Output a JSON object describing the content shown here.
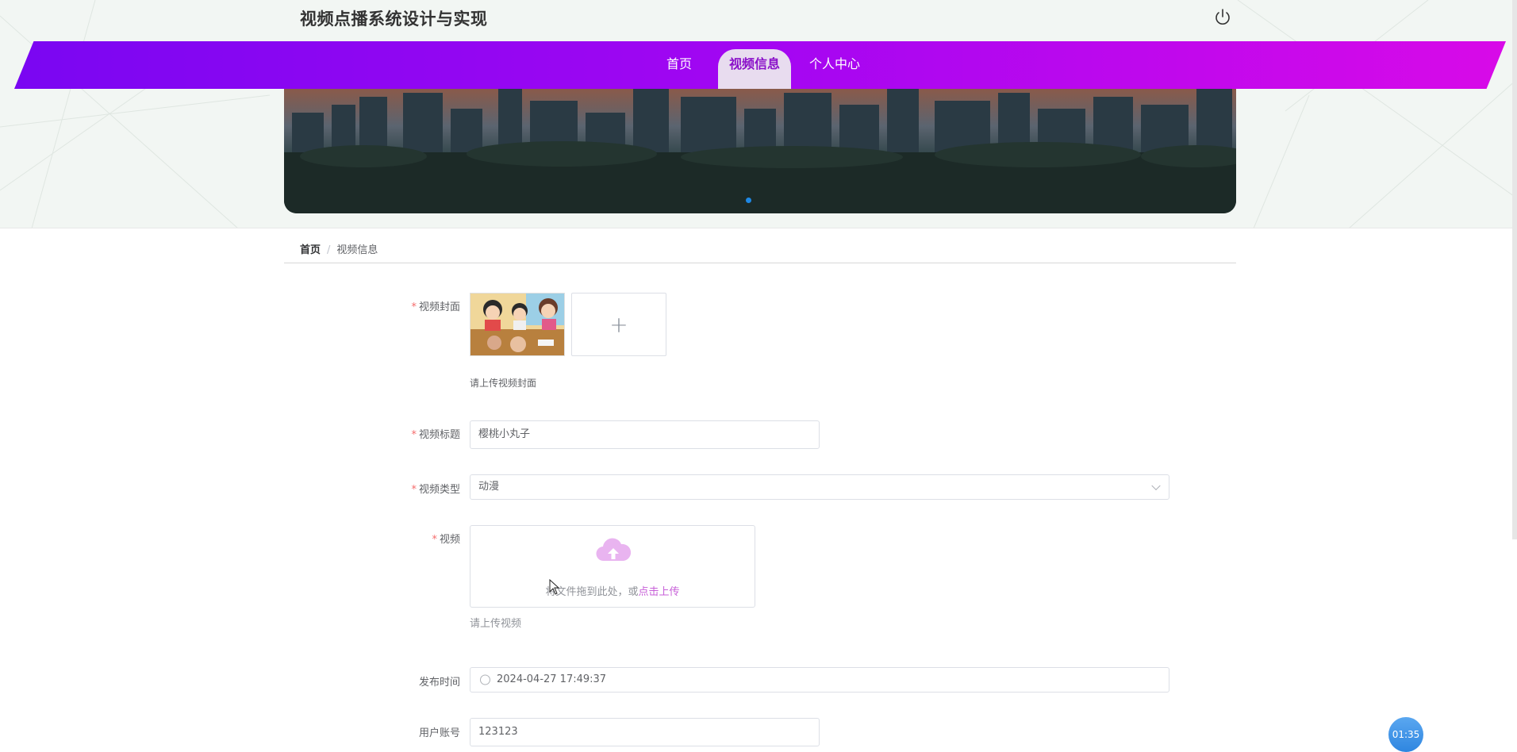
{
  "header": {
    "site_title": "视频点播系统设计与实现"
  },
  "nav": {
    "items": [
      {
        "label": "首页"
      },
      {
        "label": "视频信息",
        "active": true
      },
      {
        "label": "个人中心"
      }
    ]
  },
  "breadcrumb": {
    "home": "首页",
    "separator": "/",
    "current": "视频信息"
  },
  "form": {
    "cover": {
      "label": "视频封面",
      "hint": "请上传视频封面",
      "add_symbol": "+"
    },
    "title": {
      "label": "视频标题",
      "value": "樱桃小丸子"
    },
    "type": {
      "label": "视频类型",
      "value": "动漫"
    },
    "video": {
      "label": "视频",
      "upload_prefix": "将文件拖到此处，或",
      "upload_link": "点击上传",
      "hint": "请上传视频"
    },
    "publish_time": {
      "label": "发布时间",
      "value": "2024-04-27 17:49:37"
    },
    "account": {
      "label": "用户账号",
      "value": "123123"
    },
    "required_mark": "*"
  },
  "timer": {
    "value": "01:35"
  },
  "colors": {
    "nav_start": "#7a06f2",
    "nav_end": "#d80ae8",
    "active_text": "#8a10c9",
    "required": "#f56c6c",
    "upload_icon": "#e9b4f0"
  }
}
